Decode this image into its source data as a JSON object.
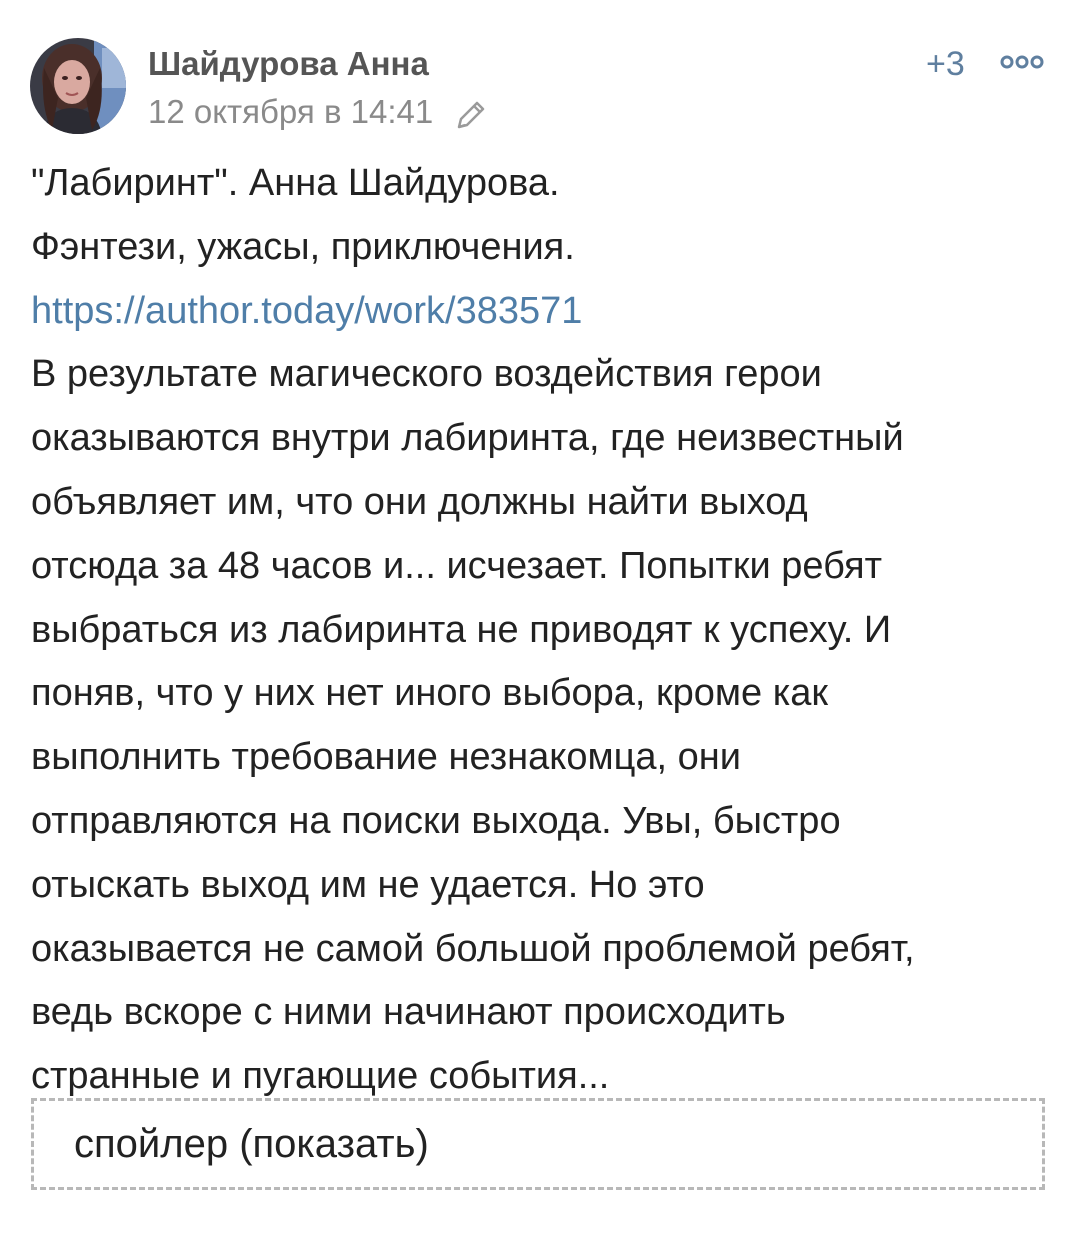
{
  "post": {
    "author": {
      "name": "Шайдурова Анна",
      "avatar_icon": "user-avatar"
    },
    "date": "12 октября в 14:41",
    "edited_icon": "pencil-icon",
    "rating": "+3",
    "more_icon": "more-dots-icon",
    "content": {
      "title_line": "\"Лабиринт\". Анна Шайдурова.",
      "genres": "Фэнтези, ужасы, приключения.",
      "link": "https://author.today/work/383571",
      "description_lines": [
        "В результате магического воздействия герои",
        "оказываются внутри лабиринта, где неизвестный",
        "объявляет им, что они должны найти выход",
        "отсюда за 48 часов и... исчезает. Попытки ребят",
        "выбраться из лабиринта не приводят к успеху. И",
        "поняв, что у них нет иного выбора, кроме как",
        "выполнить требование незнакомца, они",
        "отправляются на поиски выхода. Увы, быстро",
        "отыскать выход им не удается. Но это",
        "оказывается не самой большой проблемой ребят,",
        "ведь вскоре с ними начинают происходить",
        "странные и пугающие события..."
      ]
    },
    "spoiler_label": "спойлер (показать)"
  },
  "colors": {
    "link": "#4f7ea8",
    "rating": "#5f7f9f",
    "author": "#555555",
    "date": "#8a8a8a"
  }
}
